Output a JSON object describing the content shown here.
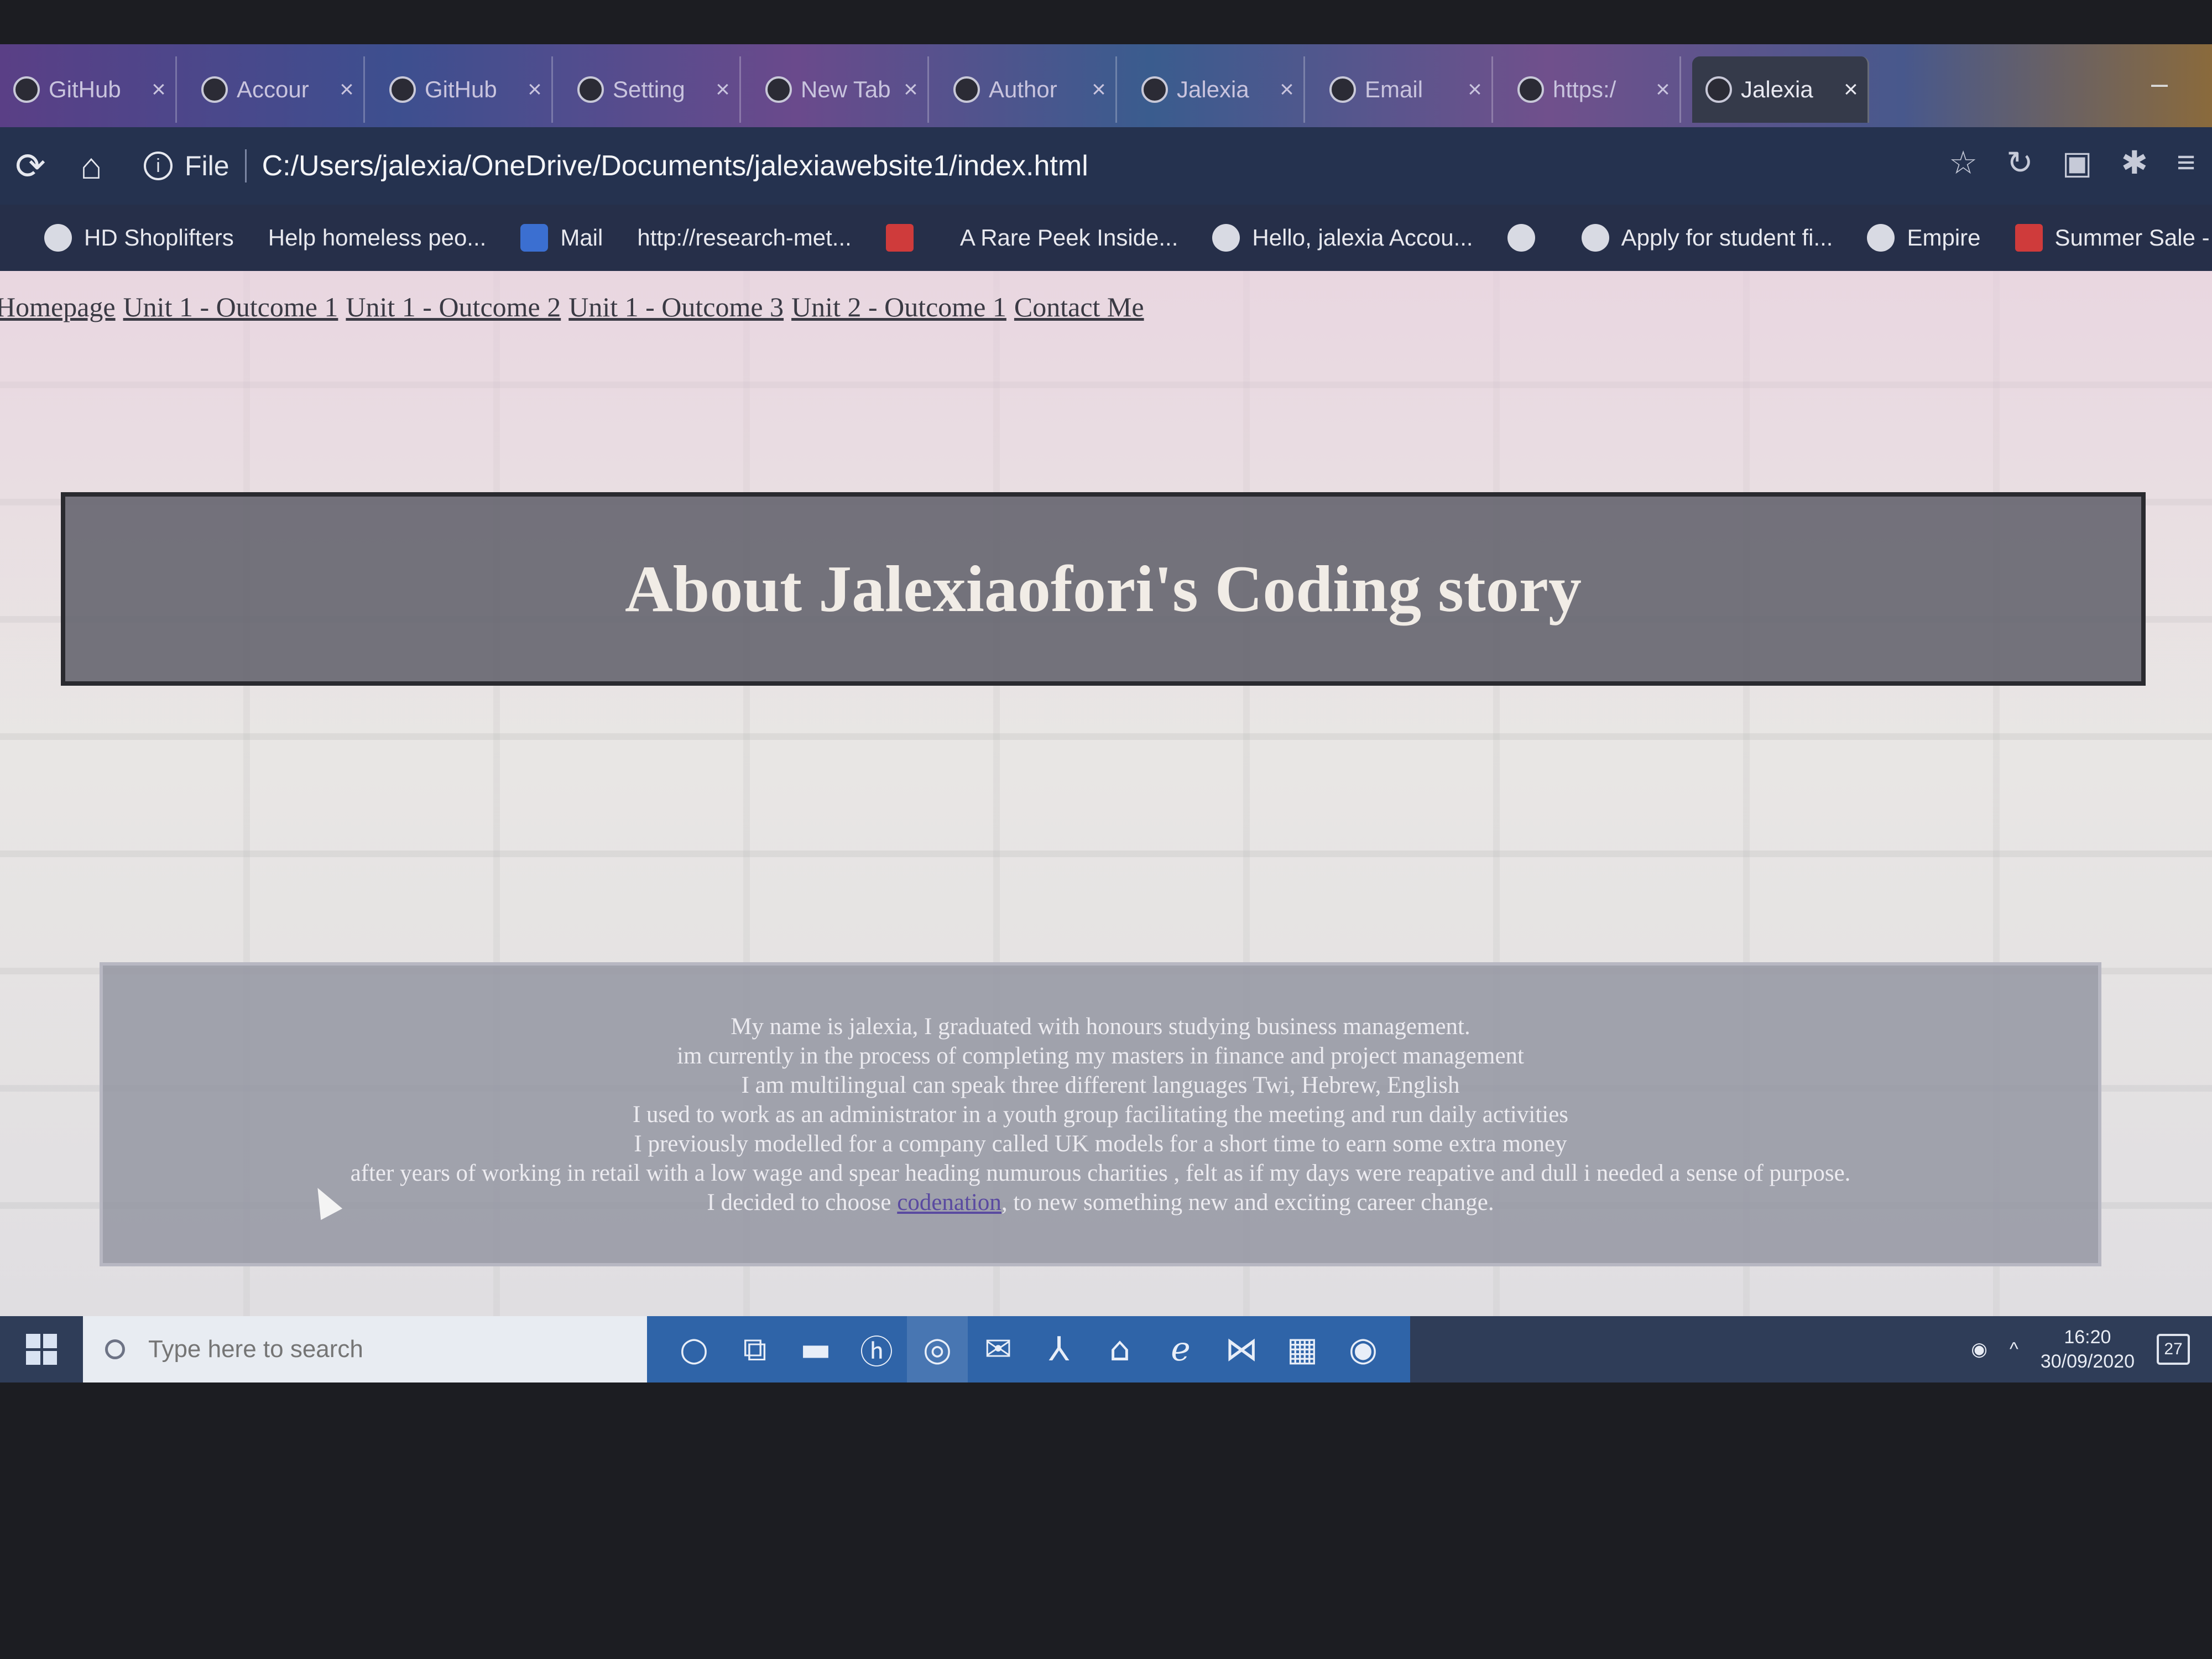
{
  "browser": {
    "tabs": [
      {
        "title": "GitHub",
        "active": false
      },
      {
        "title": "Accour",
        "active": false
      },
      {
        "title": "GitHub",
        "active": false
      },
      {
        "title": "Setting",
        "active": false
      },
      {
        "title": "New Tab",
        "active": false
      },
      {
        "title": "Author",
        "active": false
      },
      {
        "title": "Jalexia",
        "active": false
      },
      {
        "title": "Email",
        "active": false
      },
      {
        "title": "https:/",
        "active": false
      },
      {
        "title": "Jalexia",
        "active": true
      }
    ],
    "tab_close_glyph": "×",
    "address": {
      "info_label": "File",
      "url": "C:/Users/jalexia/OneDrive/Documents/jalexiawebsite1/index.html"
    },
    "bookmarks": [
      {
        "label": "HD Shoplifters",
        "icon": "globe-icon"
      },
      {
        "label": "Help homeless peo...",
        "icon": "none"
      },
      {
        "label": "Mail",
        "icon": "yahoo-icon"
      },
      {
        "label": "http://research-met...",
        "icon": "none"
      },
      {
        "label": "",
        "icon": "red-logo-icon"
      },
      {
        "label": "A Rare Peek Inside...",
        "icon": "none"
      },
      {
        "label": "Hello, jalexia Accou...",
        "icon": "amazon-icon"
      },
      {
        "label": "",
        "icon": "globe-icon"
      },
      {
        "label": "Apply for student fi...",
        "icon": "globe-icon"
      },
      {
        "label": "Empire",
        "icon": "empire-icon"
      },
      {
        "label": "Summer Sale - Sal",
        "icon": "dr-icon"
      }
    ]
  },
  "page": {
    "nav": [
      "Homepage",
      "Unit 1 - Outcome 1",
      "Unit 1 - Outcome 2",
      "Unit 1 - Outcome 3",
      "Unit 2 - Outcome 1",
      "Contact Me"
    ],
    "title": "About Jalexiaofori's Coding story",
    "story_lines": [
      "My name is jalexia, I graduated with honours studying business management.",
      "im currently in the process of completing my masters in finance and project management",
      "I am multilingual can speak three different languages Twi, Hebrew, English",
      "I used to work as an administrator in a youth group facilitating the meeting and run daily activities",
      "I previously modelled for a company called UK models for a short time to earn some extra money",
      "after years of working in retail with a low wage and spear heading numurous charities , felt as if my days were reapative and dull i needed a sense of purpose."
    ],
    "last_line": {
      "before": "I decided to choose ",
      "link": "codenation",
      "after": ", to new something new and exciting career change."
    }
  },
  "taskbar": {
    "search_placeholder": "Type here to search",
    "apps": [
      "cortana-icon",
      "task-view-icon",
      "file-explorer-icon",
      "hp-icon",
      "chrome-icon",
      "mail-icon",
      "acrobat-icon",
      "home-icon",
      "edge-icon",
      "vscode-icon",
      "store-icon",
      "media-icon"
    ],
    "time": "16:20",
    "date": "30/09/2020",
    "notifications": "27"
  },
  "colors": {
    "hero_bg": "#62626c",
    "story_bg": "#9496a2",
    "link": "#5a4aa0"
  }
}
